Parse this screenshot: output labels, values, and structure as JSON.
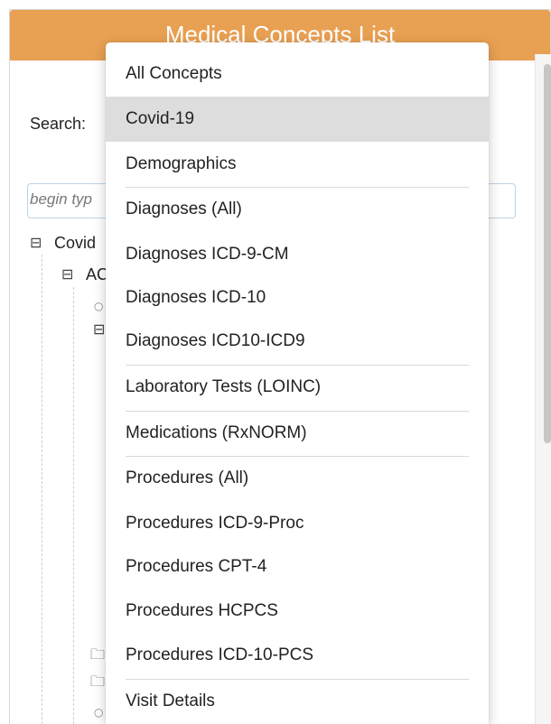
{
  "panel": {
    "title": "Medical Concepts List",
    "search_label": "Search:",
    "search_placeholder": "begin typ"
  },
  "tree": {
    "root_label": "Covid",
    "child_label": "AC",
    "expanded_icon": "minus-square-icon",
    "leaf_icon": "bullet-icon",
    "folder_icon": "folder-icon"
  },
  "dropdown": {
    "selected": "Covid-19",
    "options": [
      "All Concepts",
      "Covid-19",
      "Demographics",
      "Diagnoses (All)",
      "Diagnoses ICD-9-CM",
      "Diagnoses ICD-10",
      "Diagnoses ICD10-ICD9",
      "Laboratory Tests (LOINC)",
      "Medications (RxNORM)",
      "Procedures (All)",
      "Procedures ICD-9-Proc",
      "Procedures CPT-4",
      "Procedures HCPCS",
      "Procedures ICD-10-PCS",
      "Visit Details"
    ]
  },
  "colors": {
    "header": "#e8a052",
    "selected_bg": "#dddddd"
  }
}
